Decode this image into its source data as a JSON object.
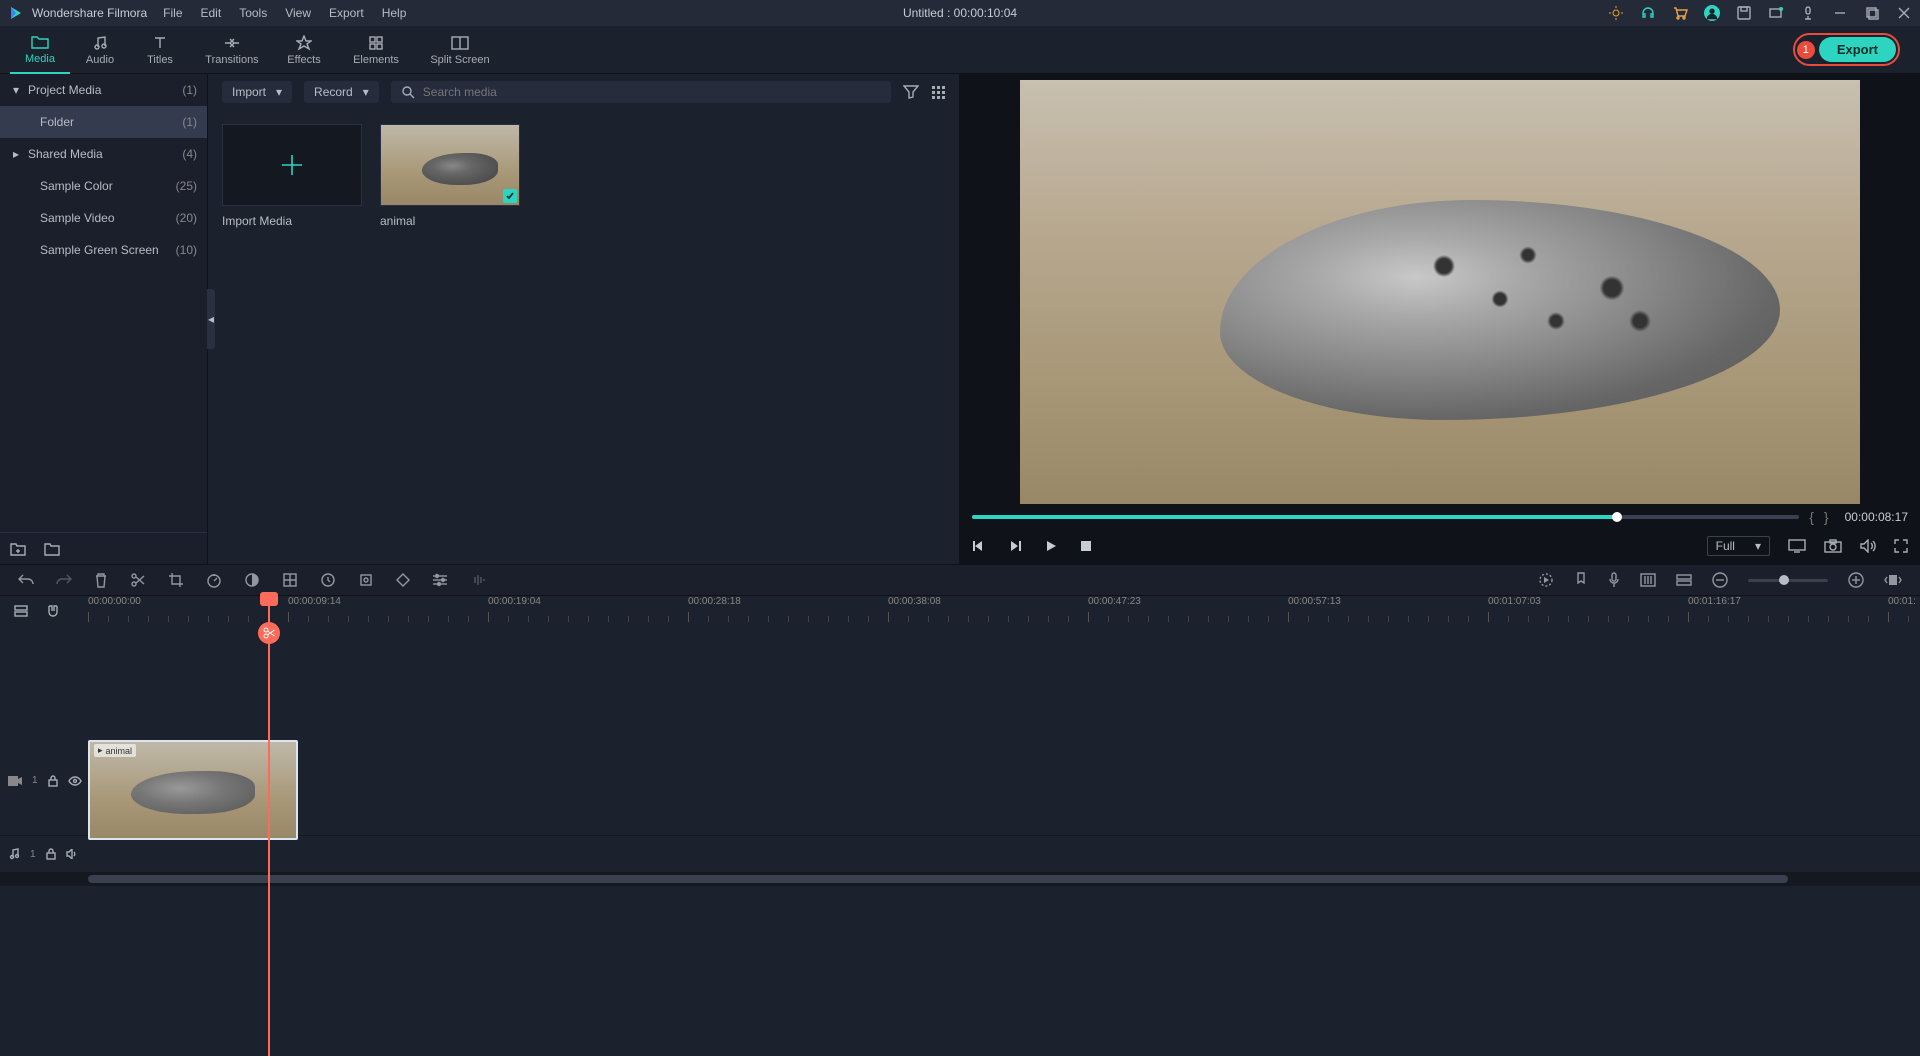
{
  "app_name": "Wondershare Filmora",
  "menu": [
    "File",
    "Edit",
    "Tools",
    "View",
    "Export",
    "Help"
  ],
  "doc_title": "Untitled : 00:00:10:04",
  "export": {
    "badge": "1",
    "label": "Export"
  },
  "tabs": [
    {
      "label": "Media",
      "active": true
    },
    {
      "label": "Audio"
    },
    {
      "label": "Titles"
    },
    {
      "label": "Transitions",
      "wide": true
    },
    {
      "label": "Effects"
    },
    {
      "label": "Elements",
      "wide": true
    },
    {
      "label": "Split Screen",
      "wide": true
    }
  ],
  "sidebar": [
    {
      "label": "Project Media",
      "count": "(1)",
      "chev": "down"
    },
    {
      "label": "Folder",
      "count": "(1)",
      "sel": true,
      "indent": true
    },
    {
      "label": "Shared Media",
      "count": "(4)",
      "chev": "right"
    },
    {
      "label": "Sample Color",
      "count": "(25)",
      "indent": true
    },
    {
      "label": "Sample Video",
      "count": "(20)",
      "indent": true
    },
    {
      "label": "Sample Green Screen",
      "count": "(10)",
      "indent": true
    }
  ],
  "media_toolbar": {
    "import": "Import",
    "record": "Record",
    "search_placeholder": "Search media"
  },
  "media_items": {
    "import_media": "Import Media",
    "clip1": "animal"
  },
  "preview": {
    "timecode": "00:00:08:17",
    "quality": "Full"
  },
  "ruler": [
    "00:00:00:00",
    "00:00:09:14",
    "00:00:19:04",
    "00:00:28:18",
    "00:00:38:08",
    "00:00:47:23",
    "00:00:57:13",
    "00:01:07:03",
    "00:01:16:17",
    "00:01:"
  ],
  "timeline": {
    "video_track_label": "1",
    "audio_track_label": "1",
    "clip_label": "animal"
  }
}
